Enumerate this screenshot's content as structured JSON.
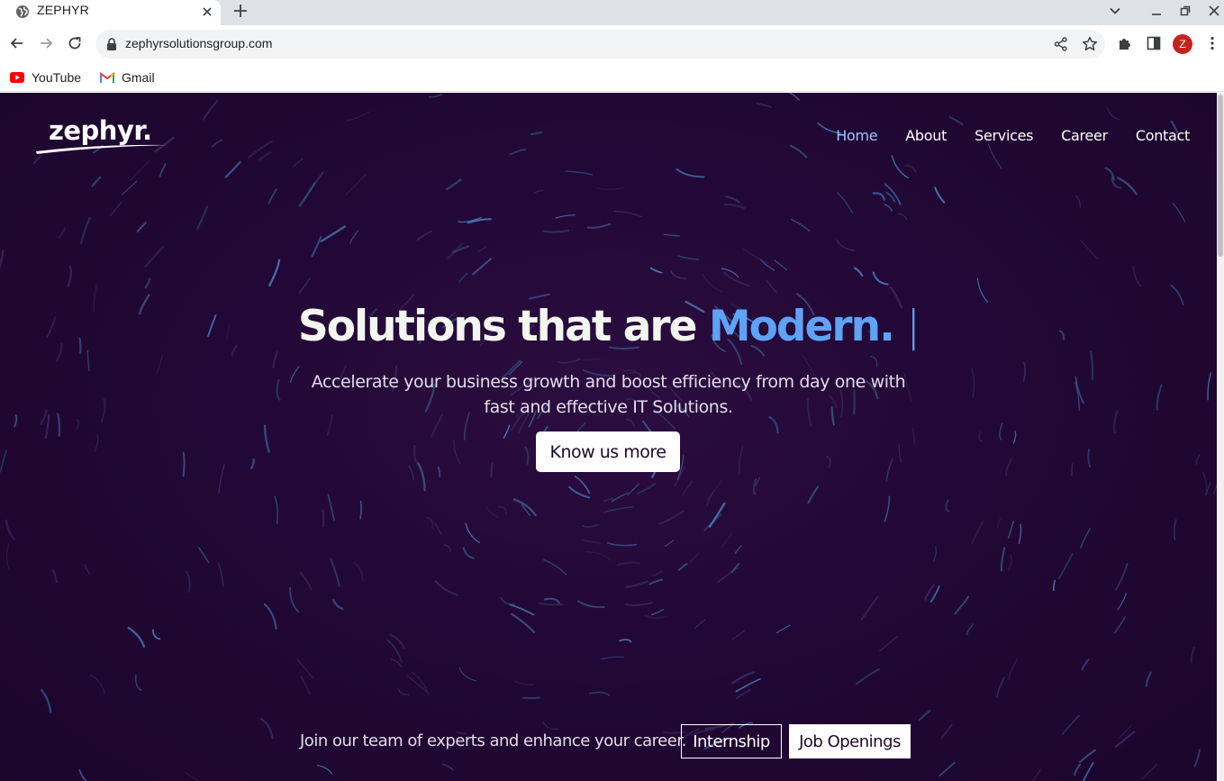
{
  "browser": {
    "tab_title": "ZEPHYR",
    "url": "zephyrsolutionsgroup.com",
    "profile_initial": "Z",
    "bookmarks": [
      {
        "label": "YouTube",
        "icon": "youtube-icon"
      },
      {
        "label": "Gmail",
        "icon": "gmail-icon"
      }
    ]
  },
  "site": {
    "logo": "zephyr.",
    "nav": [
      "Home",
      "About",
      "Services",
      "Career",
      "Contact"
    ],
    "active_nav": "Home"
  },
  "hero": {
    "title_prefix": "Solutions that are",
    "title_accent": "Modern.",
    "cursor": "|",
    "subtitle": "Accelerate your business growth and boost efficiency from day one with fast and effective IT Solutions.",
    "cta_label": "Know us more"
  },
  "career": {
    "text": "Join our team of experts and enhance your career.",
    "internship_label": "Internship",
    "jobs_label": "Job Openings"
  },
  "colors": {
    "page_background": "#220836",
    "accent": "#5ea3f5",
    "active_nav": "#9ec5fe",
    "title_text": "#f2f6ee"
  }
}
